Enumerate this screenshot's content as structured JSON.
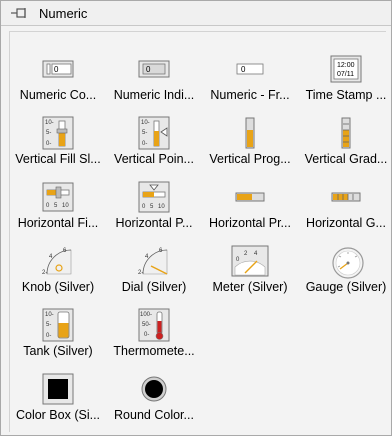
{
  "palette": {
    "title": "Numeric",
    "items": [
      {
        "label": "Numeric Co...",
        "icon": "numeric-control-icon"
      },
      {
        "label": "Numeric Indi...",
        "icon": "numeric-indicator-icon"
      },
      {
        "label": "Numeric - Fr...",
        "icon": "numeric-frameless-icon"
      },
      {
        "label": "Time Stamp ...",
        "icon": "time-stamp-icon",
        "time": "12:00",
        "date": "07/11"
      },
      {
        "label": "Vertical Fill Sl...",
        "icon": "vertical-fill-slide-icon"
      },
      {
        "label": "Vertical Poin...",
        "icon": "vertical-pointer-slide-icon"
      },
      {
        "label": "Vertical Prog...",
        "icon": "vertical-progress-bar-icon"
      },
      {
        "label": "Vertical Grad...",
        "icon": "vertical-graduated-bar-icon"
      },
      {
        "label": "Horizontal Fi...",
        "icon": "horizontal-fill-slide-icon"
      },
      {
        "label": "Horizontal P...",
        "icon": "horizontal-pointer-slide-icon"
      },
      {
        "label": "Horizontal Pr...",
        "icon": "horizontal-progress-bar-icon"
      },
      {
        "label": "Horizontal G...",
        "icon": "horizontal-graduated-bar-icon"
      },
      {
        "label": "Knob (Silver)",
        "icon": "knob-icon"
      },
      {
        "label": "Dial (Silver)",
        "icon": "dial-icon"
      },
      {
        "label": "Meter (Silver)",
        "icon": "meter-icon"
      },
      {
        "label": "Gauge (Silver)",
        "icon": "gauge-icon"
      },
      {
        "label": "Tank (Silver)",
        "icon": "tank-icon"
      },
      {
        "label": "Thermomete...",
        "icon": "thermometer-icon"
      },
      {
        "label": "Color Box (Si...",
        "icon": "color-box-icon"
      },
      {
        "label": "Round Color...",
        "icon": "round-color-box-icon"
      }
    ],
    "numeric_value": "0",
    "fill_color": "#e8a317",
    "thermo_color": "#cc2222"
  }
}
